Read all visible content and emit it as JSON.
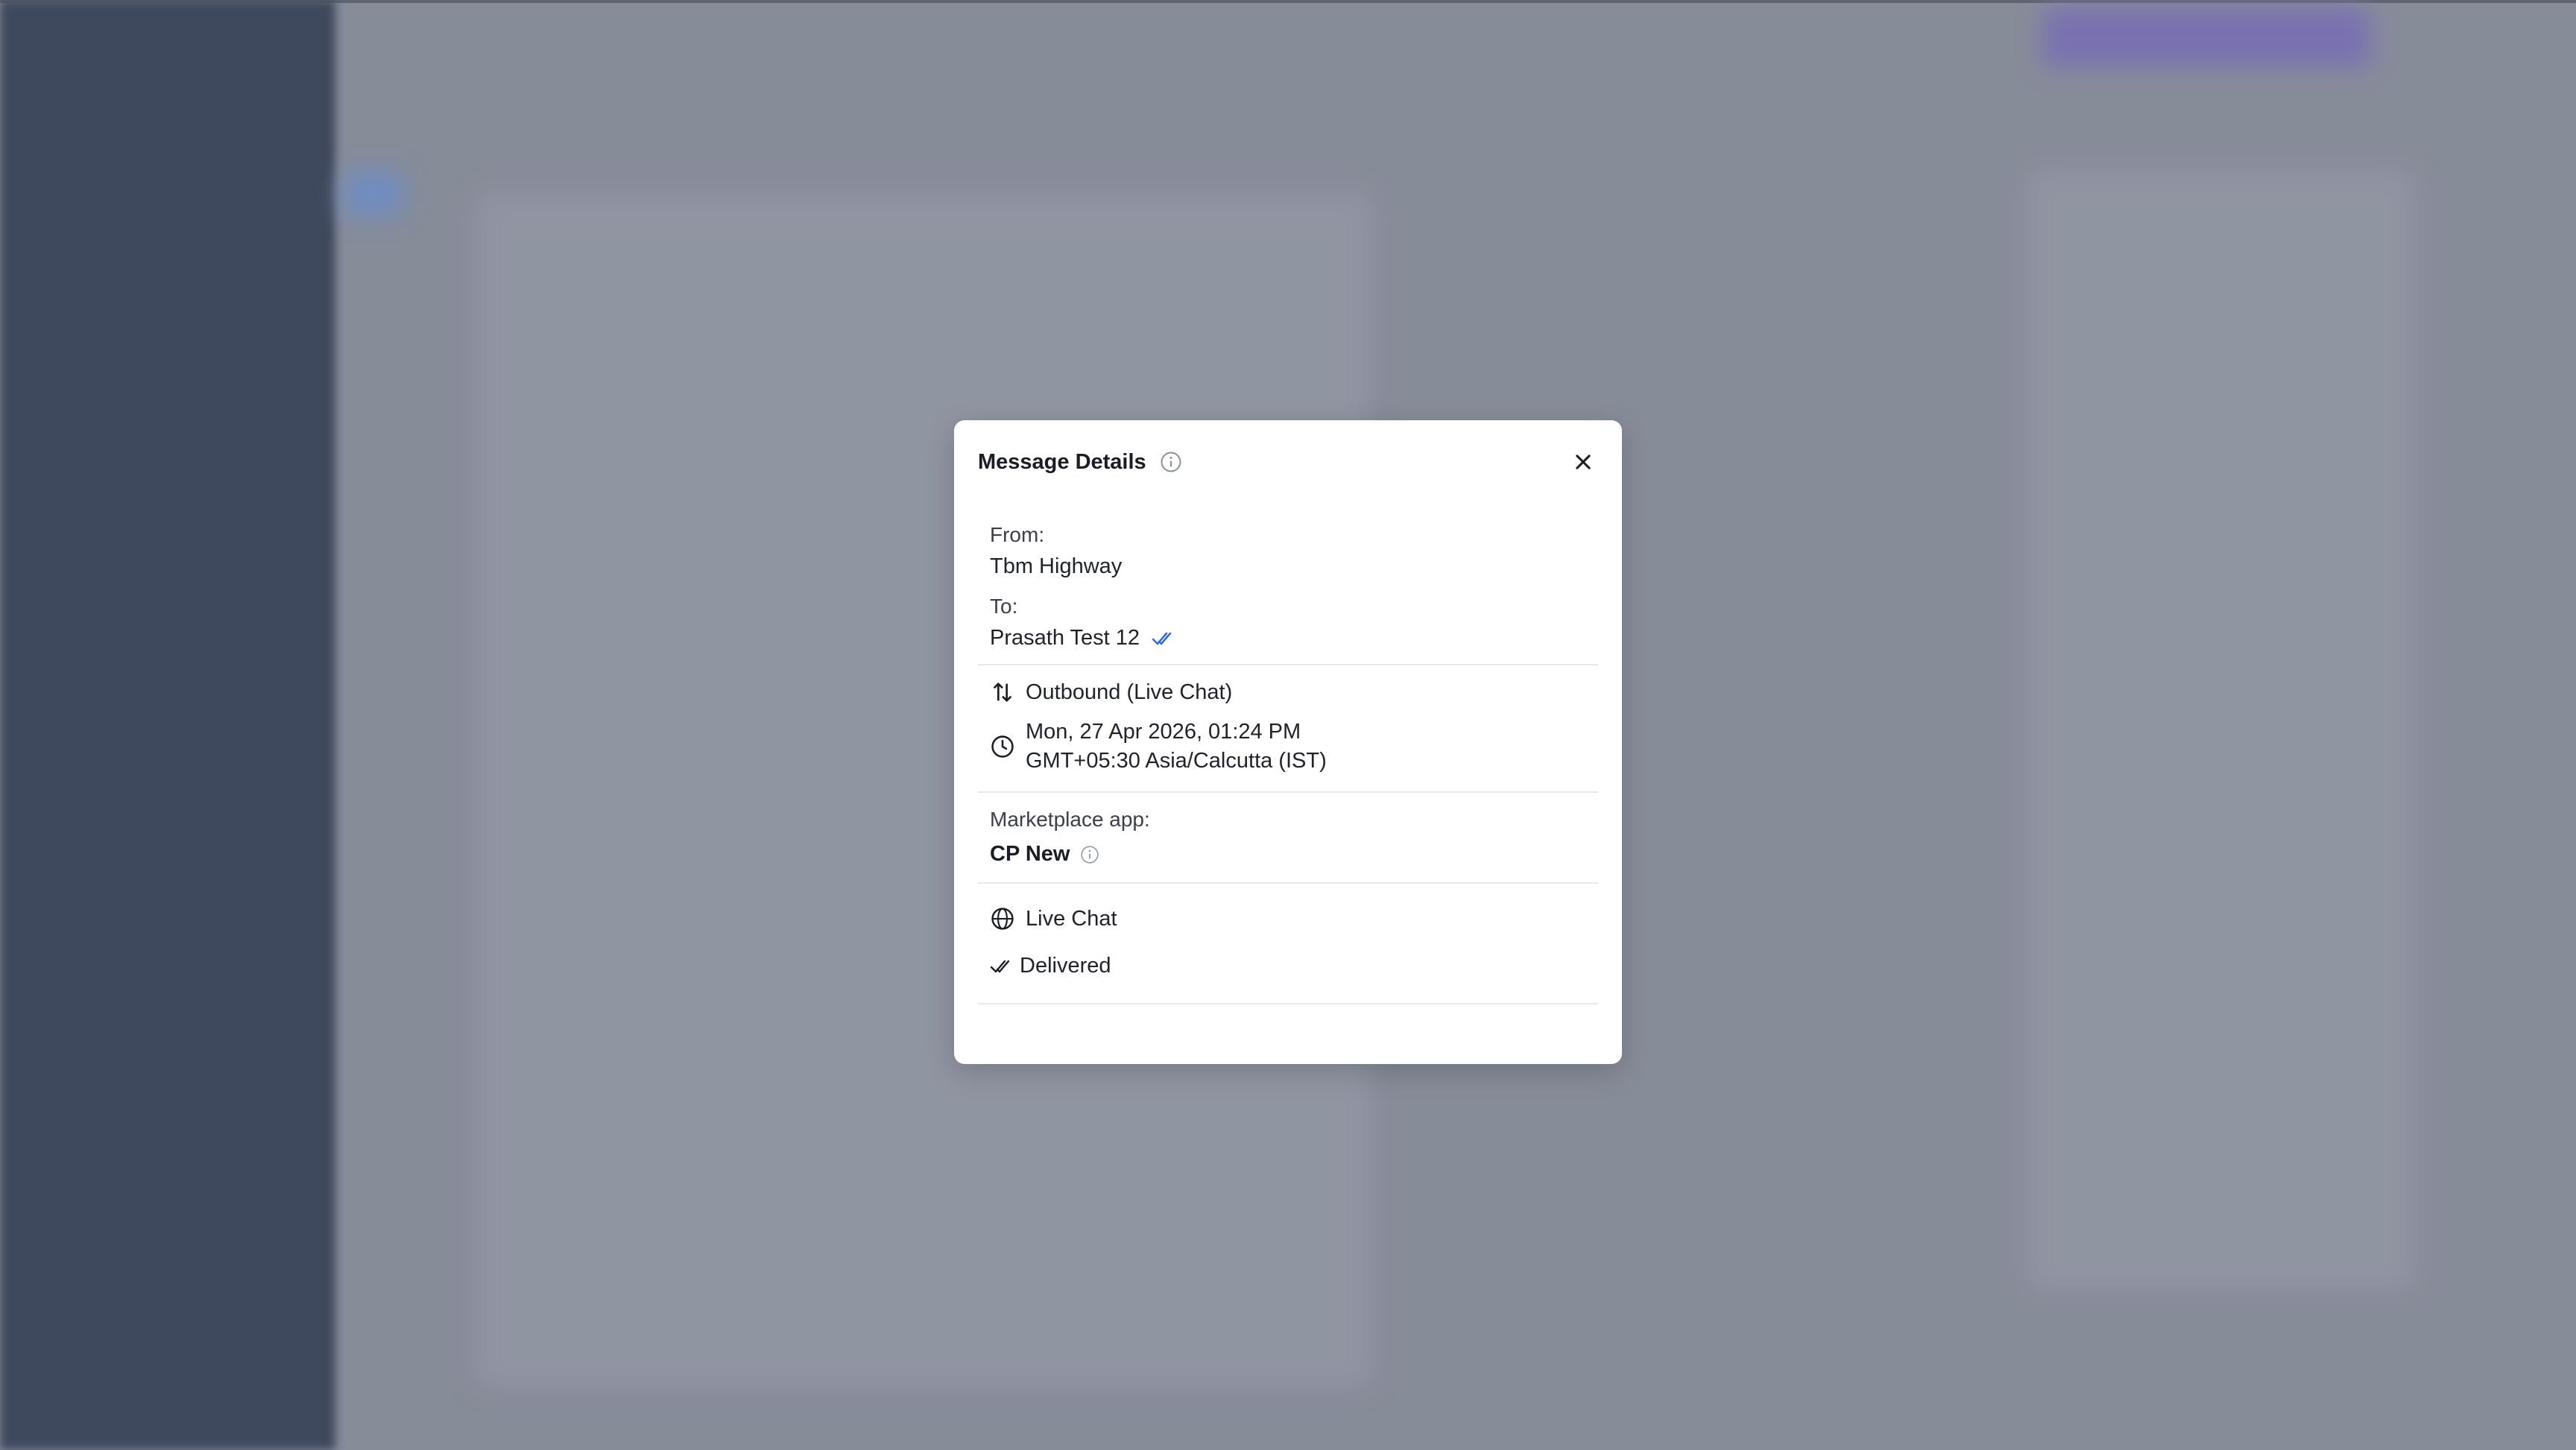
{
  "modal": {
    "title": "Message Details",
    "from_label": "From:",
    "from_value": "Tbm Highway",
    "to_label": "To:",
    "to_value": "Prasath Test 12",
    "direction": "Outbound (Live Chat)",
    "datetime": "Mon, 27 Apr 2026, 01:24 PM",
    "timezone": "GMT+05:30 Asia/Calcutta (IST)",
    "marketplace_label": "Marketplace app:",
    "marketplace_value": "CP New",
    "channel": "Live Chat",
    "status": "Delivered"
  },
  "icons": {
    "info": "info-icon",
    "close": "close-icon",
    "sort": "arrows-up-down-icon",
    "clock": "clock-icon",
    "globe": "globe-icon",
    "double_check": "double-check-icon"
  },
  "colors": {
    "tick_blue": "#2f6fd6",
    "overlay": "#8a8f9c",
    "sidebar": "#323d52"
  }
}
